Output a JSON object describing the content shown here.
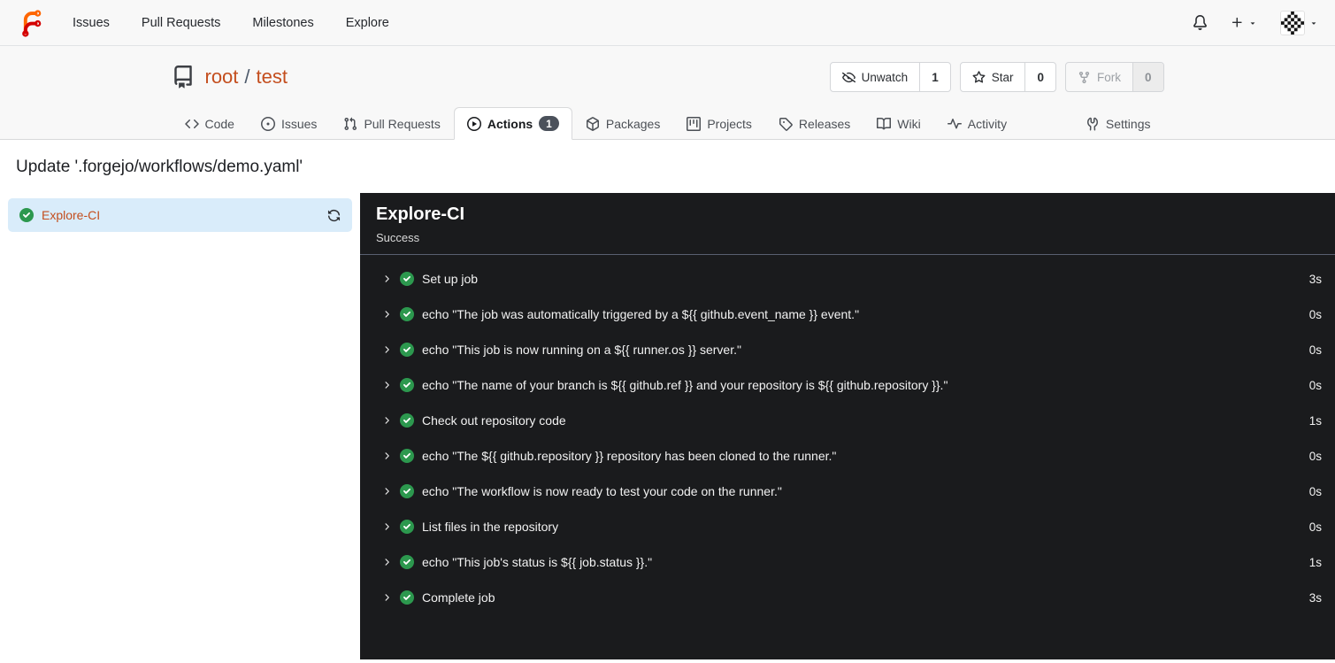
{
  "navbar": {
    "links": [
      {
        "label": "Issues"
      },
      {
        "label": "Pull Requests"
      },
      {
        "label": "Milestones"
      },
      {
        "label": "Explore"
      }
    ]
  },
  "repo": {
    "owner": "root",
    "separator": "/",
    "name": "test",
    "watch_button": {
      "label": "Unwatch",
      "count": "1"
    },
    "star_button": {
      "label": "Star",
      "count": "0"
    },
    "fork_button": {
      "label": "Fork",
      "count": "0"
    }
  },
  "tabs": {
    "code": "Code",
    "issues": "Issues",
    "pulls": "Pull Requests",
    "actions": "Actions",
    "actions_count": "1",
    "packages": "Packages",
    "projects": "Projects",
    "releases": "Releases",
    "wiki": "Wiki",
    "activity": "Activity",
    "settings": "Settings"
  },
  "page": {
    "title": "Update '.forgejo/workflows/demo.yaml'"
  },
  "sidebar": {
    "job_label": "Explore-CI"
  },
  "panel": {
    "title": "Explore-CI",
    "status": "Success",
    "steps": [
      {
        "name": "Set up job",
        "duration": "3s"
      },
      {
        "name": "echo \"The job was automatically triggered by a ${{ github.event_name }} event.\"",
        "duration": "0s"
      },
      {
        "name": "echo \"This job is now running on a ${{ runner.os }} server.\"",
        "duration": "0s"
      },
      {
        "name": "echo \"The name of your branch is ${{ github.ref }} and your repository is ${{ github.repository }}.\"",
        "duration": "0s"
      },
      {
        "name": "Check out repository code",
        "duration": "1s"
      },
      {
        "name": "echo \"The ${{ github.repository }} repository has been cloned to the runner.\"",
        "duration": "0s"
      },
      {
        "name": "echo \"The workflow is now ready to test your code on the runner.\"",
        "duration": "0s"
      },
      {
        "name": "List files in the repository",
        "duration": "0s"
      },
      {
        "name": "echo \"This job's status is ${{ job.status }}.\"",
        "duration": "1s"
      },
      {
        "name": "Complete job",
        "duration": "3s"
      }
    ]
  },
  "colors": {
    "accent_orange": "#c44e1e",
    "success_green": "#2c984e",
    "panel_background": "#1a1b1d",
    "selected_row_blue": "#d9ecfa",
    "badge_gray": "#4b515b"
  }
}
